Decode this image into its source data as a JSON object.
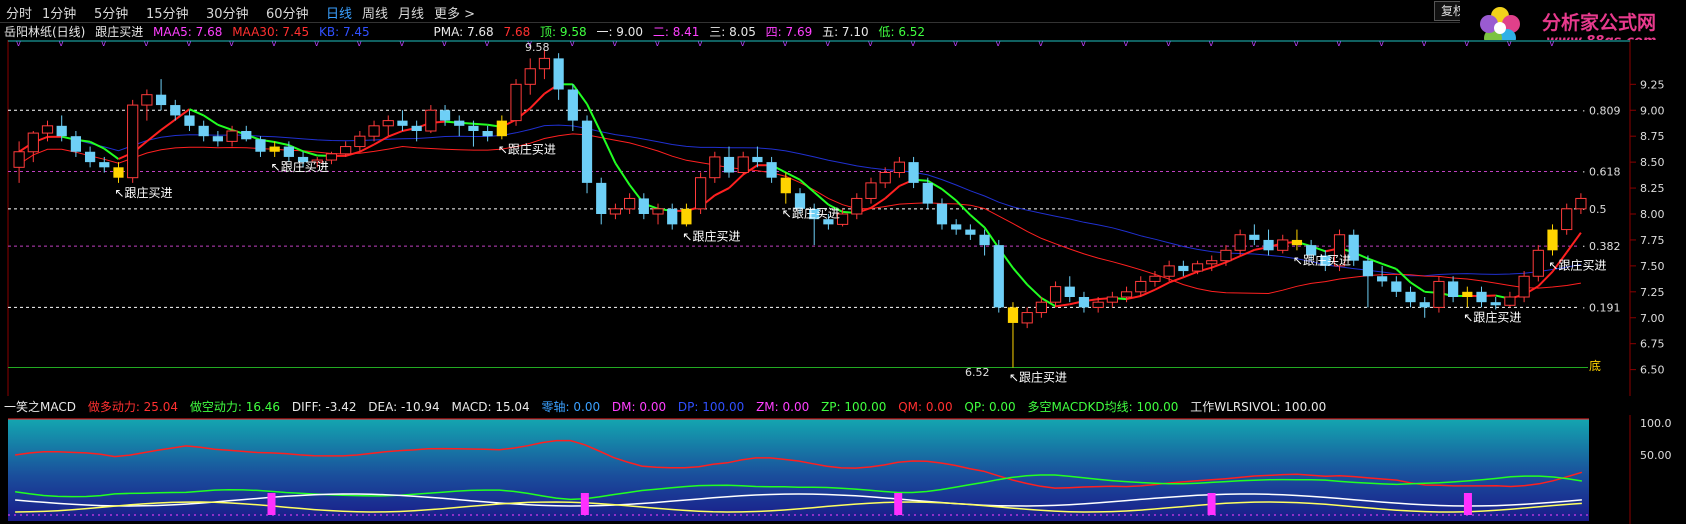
{
  "toolbar": {
    "periods": [
      "分时",
      "1分钟",
      "5分钟",
      "15分钟",
      "30分钟",
      "60分钟",
      "日线",
      "周线",
      "月线",
      "更多 >"
    ],
    "active_period": "日线",
    "buttons": [
      "复权",
      "叠"
    ]
  },
  "logo": {
    "name": "分析家公式网",
    "url": "www.88gs.com"
  },
  "info_line": {
    "stock": "岳阳林纸(日线)",
    "indicator": "跟庄买进",
    "maa5": "MAA5: 7.68",
    "maa30": "MAA30: 7.45",
    "kb": "KB: 7.45",
    "pma": "PMA: 7.68",
    "pma_val": "7.68",
    "top": "顶: 9.58",
    "l1": "一: 9.00",
    "l2": "二: 8.41",
    "l3": "三: 8.05",
    "l4": "四: 7.69",
    "l5": "五: 7.10",
    "low": "低: 6.52"
  },
  "price_axis": {
    "ticks": [
      "9.25",
      "9.00",
      "8.75",
      "8.50",
      "8.25",
      "8.00",
      "7.75",
      "7.50",
      "7.25",
      "7.00",
      "6.75",
      "6.50"
    ],
    "fib_labels": [
      "0.809",
      "0.618",
      "0.5",
      "0.382",
      "0.191"
    ],
    "bottom_label": "底",
    "high_label": "9.58",
    "low_label": "6.52",
    "buy_label": "跟庄买进"
  },
  "macd_line": {
    "name": "一笑之MACD",
    "duo": "做多动力: 25.04",
    "kong": "做空动力: 16.46",
    "diff": "DIFF: -3.42",
    "dea": "DEA: -10.94",
    "macd": "MACD: 15.04",
    "zero": "零轴: 0.00",
    "dm": "DM: 0.00",
    "dp": "DP: 100.00",
    "zm": "ZM: 0.00",
    "zp": "ZP: 100.00",
    "qm": "QM: 0.00",
    "qp": "QP: 0.00",
    "kd": "多空MACDKD均线: 100.00",
    "wl": "工作WLRSIVOL: 100.00"
  },
  "macd_axis": {
    "ticks": [
      "100.0",
      "50.00"
    ]
  },
  "colors": {
    "up": "#ff3b3b",
    "down": "#6ecff6",
    "buy": "#ffd400",
    "ma_red": "#ff2020",
    "ma_green": "#22ff22",
    "ma_white": "#ffffff",
    "ma_blue": "#2030d0",
    "fib_white": "#ffffff",
    "fib_purple": "#c040c0",
    "active": "#3aa0ff"
  },
  "chart_data": [
    {
      "type": "candlestick",
      "ylim": [
        6.4,
        9.6
      ],
      "y_ticks": [
        6.5,
        6.75,
        7.0,
        7.25,
        7.5,
        7.75,
        8.0,
        8.25,
        8.5,
        8.75,
        9.0,
        9.25
      ],
      "fib_levels": [
        {
          "label": "0.809",
          "value": 9.0
        },
        {
          "label": "0.618",
          "value": 8.41
        },
        {
          "label": "0.5",
          "value": 8.05
        },
        {
          "label": "0.382",
          "value": 7.69
        },
        {
          "label": "0.191",
          "value": 7.1
        }
      ],
      "bottom_level": 6.52,
      "ohlc": [
        [
          8.45,
          8.7,
          8.3,
          8.6
        ],
        [
          8.6,
          8.8,
          8.5,
          8.78
        ],
        [
          8.78,
          8.9,
          8.7,
          8.85
        ],
        [
          8.85,
          8.95,
          8.7,
          8.75
        ],
        [
          8.75,
          8.8,
          8.55,
          8.6
        ],
        [
          8.6,
          8.65,
          8.45,
          8.5
        ],
        [
          8.5,
          8.55,
          8.4,
          8.45
        ],
        [
          8.45,
          8.5,
          8.3,
          8.35
        ],
        [
          8.35,
          9.1,
          8.3,
          9.05
        ],
        [
          9.05,
          9.2,
          8.9,
          9.15
        ],
        [
          9.15,
          9.3,
          9.0,
          9.05
        ],
        [
          9.05,
          9.1,
          8.9,
          8.95
        ],
        [
          8.95,
          9.0,
          8.8,
          8.85
        ],
        [
          8.85,
          8.9,
          8.7,
          8.75
        ],
        [
          8.75,
          8.8,
          8.65,
          8.7
        ],
        [
          8.7,
          8.85,
          8.65,
          8.8
        ],
        [
          8.8,
          8.85,
          8.7,
          8.72
        ],
        [
          8.72,
          8.75,
          8.55,
          8.6
        ],
        [
          8.6,
          8.7,
          8.55,
          8.65
        ],
        [
          8.65,
          8.7,
          8.5,
          8.55
        ],
        [
          8.55,
          8.6,
          8.45,
          8.5
        ],
        [
          8.5,
          8.55,
          8.45,
          8.52
        ],
        [
          8.52,
          8.6,
          8.48,
          8.58
        ],
        [
          8.58,
          8.7,
          8.55,
          8.65
        ],
        [
          8.65,
          8.8,
          8.6,
          8.75
        ],
        [
          8.75,
          8.9,
          8.7,
          8.85
        ],
        [
          8.85,
          8.95,
          8.75,
          8.9
        ],
        [
          8.9,
          9.0,
          8.8,
          8.85
        ],
        [
          8.85,
          8.9,
          8.7,
          8.8
        ],
        [
          8.8,
          9.05,
          8.78,
          9.0
        ],
        [
          9.0,
          9.05,
          8.85,
          8.9
        ],
        [
          8.9,
          8.95,
          8.75,
          8.85
        ],
        [
          8.85,
          8.9,
          8.65,
          8.8
        ],
        [
          8.8,
          8.85,
          8.7,
          8.75
        ],
        [
          8.75,
          8.95,
          8.72,
          8.9
        ],
        [
          8.9,
          9.3,
          8.85,
          9.25
        ],
        [
          9.25,
          9.5,
          9.15,
          9.4
        ],
        [
          9.4,
          9.58,
          9.3,
          9.5
        ],
        [
          9.5,
          9.55,
          9.1,
          9.2
        ],
        [
          9.2,
          9.25,
          8.8,
          8.9
        ],
        [
          8.9,
          8.95,
          8.2,
          8.3
        ],
        [
          8.3,
          8.35,
          7.9,
          8.0
        ],
        [
          8.0,
          8.1,
          7.95,
          8.05
        ],
        [
          8.05,
          8.2,
          8.0,
          8.15
        ],
        [
          8.15,
          8.2,
          7.95,
          8.0
        ],
        [
          8.0,
          8.1,
          7.9,
          8.05
        ],
        [
          8.05,
          8.1,
          7.85,
          7.9
        ],
        [
          7.9,
          8.1,
          7.88,
          8.05
        ],
        [
          8.05,
          8.4,
          8.0,
          8.35
        ],
        [
          8.35,
          8.6,
          8.3,
          8.55
        ],
        [
          8.55,
          8.65,
          8.35,
          8.4
        ],
        [
          8.4,
          8.6,
          8.38,
          8.55
        ],
        [
          8.55,
          8.65,
          8.45,
          8.5
        ],
        [
          8.5,
          8.55,
          8.3,
          8.35
        ],
        [
          8.35,
          8.4,
          8.1,
          8.2
        ],
        [
          8.2,
          8.25,
          8.0,
          8.05
        ],
        [
          8.05,
          8.1,
          7.7,
          7.95
        ],
        [
          7.95,
          8.0,
          7.85,
          7.9
        ],
        [
          7.9,
          8.05,
          7.88,
          8.0
        ],
        [
          8.0,
          8.2,
          7.95,
          8.15
        ],
        [
          8.15,
          8.35,
          8.1,
          8.3
        ],
        [
          8.3,
          8.45,
          8.25,
          8.4
        ],
        [
          8.4,
          8.55,
          8.35,
          8.5
        ],
        [
          8.5,
          8.55,
          8.25,
          8.3
        ],
        [
          8.3,
          8.35,
          8.05,
          8.1
        ],
        [
          8.1,
          8.15,
          7.85,
          7.9
        ],
        [
          7.9,
          7.95,
          7.8,
          7.85
        ],
        [
          7.85,
          7.9,
          7.75,
          7.8
        ],
        [
          7.8,
          7.85,
          7.6,
          7.7
        ],
        [
          7.7,
          7.75,
          7.05,
          7.1
        ],
        [
          7.1,
          7.15,
          6.52,
          6.95
        ],
        [
          6.95,
          7.1,
          6.9,
          7.05
        ],
        [
          7.05,
          7.2,
          7.0,
          7.15
        ],
        [
          7.15,
          7.35,
          7.1,
          7.3
        ],
        [
          7.3,
          7.4,
          7.15,
          7.2
        ],
        [
          7.2,
          7.25,
          7.05,
          7.1
        ],
        [
          7.1,
          7.2,
          7.05,
          7.15
        ],
        [
          7.15,
          7.25,
          7.1,
          7.2
        ],
        [
          7.2,
          7.3,
          7.15,
          7.25
        ],
        [
          7.25,
          7.4,
          7.2,
          7.35
        ],
        [
          7.35,
          7.45,
          7.3,
          7.4
        ],
        [
          7.4,
          7.55,
          7.35,
          7.5
        ],
        [
          7.5,
          7.55,
          7.4,
          7.45
        ],
        [
          7.45,
          7.55,
          7.42,
          7.52
        ],
        [
          7.52,
          7.6,
          7.45,
          7.55
        ],
        [
          7.55,
          7.7,
          7.5,
          7.65
        ],
        [
          7.65,
          7.85,
          7.6,
          7.8
        ],
        [
          7.8,
          7.9,
          7.7,
          7.75
        ],
        [
          7.75,
          7.85,
          7.6,
          7.65
        ],
        [
          7.65,
          7.8,
          7.62,
          7.75
        ],
        [
          7.75,
          7.85,
          7.65,
          7.7
        ],
        [
          7.7,
          7.75,
          7.55,
          7.6
        ],
        [
          7.6,
          7.65,
          7.45,
          7.5
        ],
        [
          7.5,
          7.85,
          7.45,
          7.8
        ],
        [
          7.8,
          7.85,
          7.5,
          7.55
        ],
        [
          7.55,
          7.6,
          7.1,
          7.4
        ],
        [
          7.4,
          7.5,
          7.3,
          7.35
        ],
        [
          7.35,
          7.4,
          7.2,
          7.25
        ],
        [
          7.25,
          7.3,
          7.1,
          7.15
        ],
        [
          7.15,
          7.2,
          7.0,
          7.1
        ],
        [
          7.1,
          7.4,
          7.05,
          7.35
        ],
        [
          7.35,
          7.4,
          7.15,
          7.2
        ],
        [
          7.2,
          7.3,
          7.1,
          7.25
        ],
        [
          7.25,
          7.3,
          7.1,
          7.15
        ],
        [
          7.15,
          7.2,
          7.08,
          7.12
        ],
        [
          7.12,
          7.25,
          7.1,
          7.2
        ],
        [
          7.2,
          7.45,
          7.15,
          7.4
        ],
        [
          7.4,
          7.7,
          7.35,
          7.65
        ],
        [
          7.65,
          7.9,
          7.6,
          7.85
        ],
        [
          7.85,
          8.1,
          7.8,
          8.05
        ],
        [
          8.05,
          8.2,
          8.0,
          8.15
        ]
      ],
      "high_label_value": 9.58,
      "low_label_value": 6.52,
      "buy_signals": [
        7,
        18,
        34,
        47,
        54,
        70,
        90,
        102,
        108
      ]
    },
    {
      "type": "line",
      "ylim": [
        0,
        110
      ],
      "y_ticks": [
        100,
        50
      ],
      "series": [
        {
          "name": "做多动力",
          "color": "#ff2020"
        },
        {
          "name": "做空动力",
          "color": "#22ff22"
        }
      ]
    }
  ]
}
